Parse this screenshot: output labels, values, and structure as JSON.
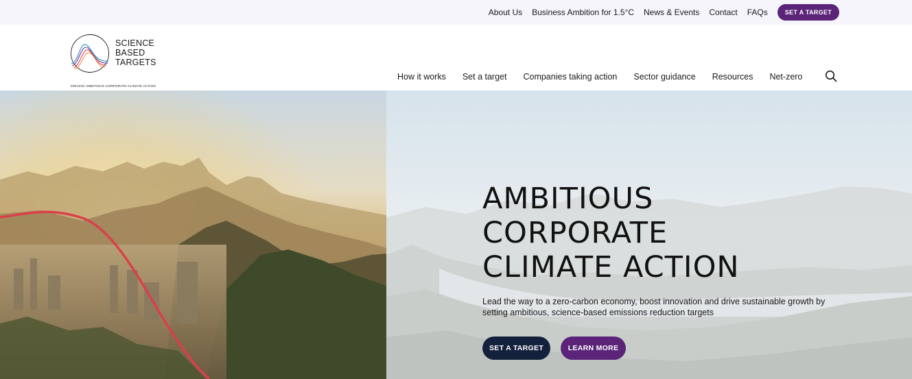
{
  "utility_nav": {
    "links": [
      "About Us",
      "Business Ambition for 1.5°C",
      "News & Events",
      "Contact",
      "FAQs"
    ],
    "cta_label": "SET A TARGET"
  },
  "logo": {
    "lines": [
      "SCIENCE",
      "BASED",
      "TARGETS"
    ],
    "tagline": "DRIVING AMBITIOUS CORPORATE CLIMATE ACTION"
  },
  "main_nav": {
    "items": [
      "How it works",
      "Set a target",
      "Companies taking action",
      "Sector guidance",
      "Resources",
      "Net-zero"
    ],
    "search_icon": "search-icon"
  },
  "hero": {
    "title_lines": [
      "AMBITIOUS",
      "CORPORATE",
      "CLIMATE ACTION"
    ],
    "subtitle": "Lead the way to a zero-carbon economy, boost innovation and drive sustainable growth by setting ambitious, science-based emissions reduction targets",
    "primary_button": "SET A TARGET",
    "secondary_button": "LEARN MORE"
  },
  "colors": {
    "brand_purple": "#5b2479",
    "dark_navy": "#14213d",
    "utility_bg": "#f6f5fb",
    "curve_red": "#d9404a"
  }
}
